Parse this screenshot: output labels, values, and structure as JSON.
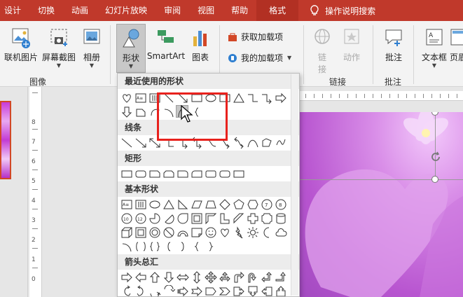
{
  "tabs": [
    {
      "label": "设计",
      "active": false
    },
    {
      "label": "切换",
      "active": false
    },
    {
      "label": "动画",
      "active": false
    },
    {
      "label": "幻灯片放映",
      "active": false
    },
    {
      "label": "审阅",
      "active": false
    },
    {
      "label": "视图",
      "active": false
    },
    {
      "label": "帮助",
      "active": false
    },
    {
      "label": "格式",
      "active": true
    }
  ],
  "tell_me": "操作说明搜索",
  "ribbon": {
    "online_pictures": "联机图片",
    "screenshot": "屏幕截图",
    "album": "相册",
    "shapes": "形状",
    "smartart": "SmartArt",
    "chart": "图表",
    "get_addins": "获取加载项",
    "my_addins": "我的加载项",
    "link_label": "链",
    "link_label2": "接",
    "action": "动作",
    "comment": "批注",
    "textbox": "文本框",
    "header": "页眉",
    "group_images": "图像",
    "group_links": "链接",
    "group_comments": "批注"
  },
  "dropdown": {
    "recent": "最近使用的形状",
    "lines": "线条",
    "rectangles": "矩形",
    "basic": "基本形状",
    "arrows": "箭头总汇"
  },
  "colors": {
    "tab_bar": "#c0392b",
    "highlight_box": "#e8211d",
    "slide_accent": "#b855d0"
  }
}
